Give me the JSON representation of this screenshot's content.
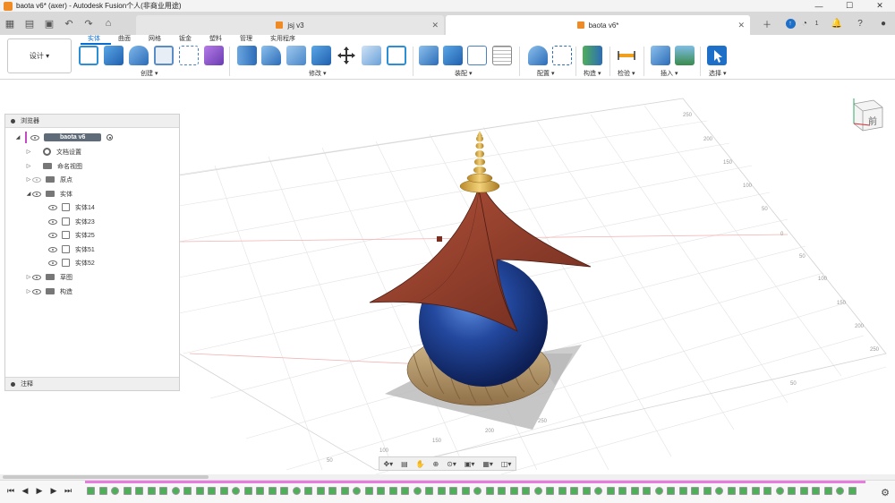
{
  "window": {
    "title": "baota v6* (axer) - Autodesk Fusion个人(非商业用途)",
    "controls": [
      "—",
      "☐",
      "✕"
    ]
  },
  "tabs": [
    {
      "label": "jsj v3",
      "active": false
    },
    {
      "label": "baota v6*",
      "active": true
    }
  ],
  "tabbar_right": {
    "notification_count": "1"
  },
  "ribbon": {
    "workspace": "设计 ▾",
    "tabs": [
      "实体",
      "曲面",
      "网格",
      "钣金",
      "塑料",
      "管理",
      "实用程序"
    ],
    "active_tab": "实体",
    "groups": [
      "创建 ▾",
      "修改 ▾",
      "装配 ▾",
      "配置 ▾",
      "构造 ▾",
      "检验 ▾",
      "插入 ▾",
      "选择 ▾"
    ]
  },
  "browser": {
    "title": "浏览器",
    "root": "baota v6",
    "items": [
      {
        "label": "文档设置",
        "icon": "gear-icon"
      },
      {
        "label": "命名视图",
        "icon": "folder-icon"
      },
      {
        "label": "原点",
        "icon": "folder-icon"
      },
      {
        "label": "实体",
        "icon": "folder-icon"
      },
      {
        "label": "实体14",
        "icon": "body-icon"
      },
      {
        "label": "实体23",
        "icon": "body-icon"
      },
      {
        "label": "实体25",
        "icon": "body-icon"
      },
      {
        "label": "实体51",
        "icon": "body-icon"
      },
      {
        "label": "实体52",
        "icon": "body-icon"
      },
      {
        "label": "草图",
        "icon": "folder-icon"
      },
      {
        "label": "构造",
        "icon": "folder-icon"
      }
    ],
    "comments": "注释"
  },
  "viewcube": {
    "face": "前"
  },
  "grid_labels": {
    "right": [
      "250",
      "200",
      "150",
      "100",
      "50",
      "0",
      "50",
      "100",
      "150",
      "200",
      "250"
    ],
    "bottom": [
      "50",
      "100",
      "150",
      "200",
      "250",
      "50"
    ]
  },
  "colors": {
    "accent": "#0a6bd0",
    "roof": "#8b3b2a",
    "sphere": "#1f3f8f",
    "gold": "#d9b24a",
    "rope": "#b89968",
    "timeline_track": "#e77be0"
  }
}
